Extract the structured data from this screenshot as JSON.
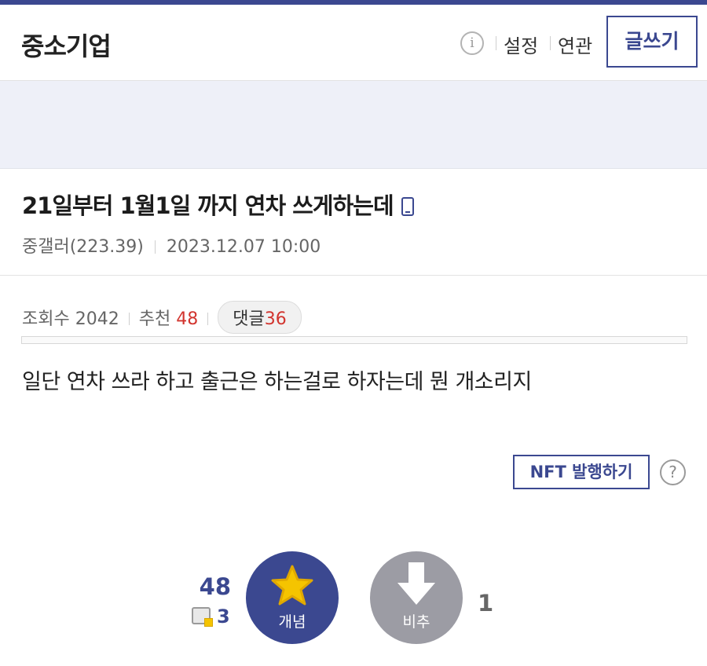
{
  "header": {
    "gallery_title": "중소기업",
    "settings_label": "설정",
    "related_label": "연관",
    "write_label": "글쓰기"
  },
  "post": {
    "title": "21일부터 1월1일 까지 연차 쓰게하는데",
    "author": "중갤러(223.39)",
    "datetime": "2023.12.07 10:00",
    "views_label": "조회수",
    "views": "2042",
    "recommend_label": "추천",
    "recommend": "48",
    "comments_label": "댓글",
    "comments": "36",
    "body": "일단 연차 쓰라 하고 출근은 하는걸로 하자는데 뭔 개소리지"
  },
  "actions": {
    "nft_label": "NFT 발행하기",
    "recommend_count": "48",
    "fixed_recommend_count": "3",
    "recommend_button_label": "개념",
    "nonrecommend_button_label": "비추",
    "nonrecommend_count": "1"
  },
  "colors": {
    "accent": "#3b4890",
    "highlight_red": "#d2352f",
    "star_yellow": "#f5c400",
    "nonrecommend_gray": "#9c9ca4"
  },
  "icons": {
    "info": "info-icon",
    "mobile": "mobile-phone-icon",
    "help": "question-icon",
    "star": "star-icon",
    "down": "arrow-down-icon",
    "fixed": "fixed-recommend-icon"
  }
}
